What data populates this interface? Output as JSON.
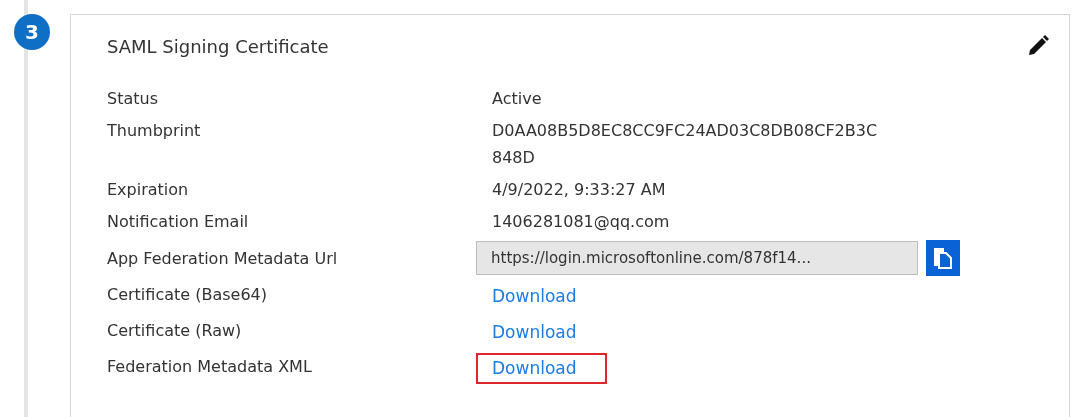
{
  "step": {
    "number": "3"
  },
  "card": {
    "title": "SAML Signing Certificate",
    "rows": [
      {
        "kind": "text",
        "label": "Status",
        "value": "Active"
      },
      {
        "kind": "text",
        "label": "Thumbprint",
        "value": "D0AA08B5D8EC8CC9FC24AD03C8DB08CF2B3C848D"
      },
      {
        "kind": "text",
        "label": "Expiration",
        "value": "4/9/2022, 9:33:27 AM"
      },
      {
        "kind": "text",
        "label": "Notification Email",
        "value": "1406281081@qq.com"
      },
      {
        "kind": "field",
        "label": "App Federation Metadata Url",
        "value": "https://login.microsoftonline.com/878f14..."
      },
      {
        "kind": "link",
        "label": "Certificate (Base64)",
        "value": "Download",
        "highlighted": false
      },
      {
        "kind": "link",
        "label": "Certificate (Raw)",
        "value": "Download",
        "highlighted": false
      },
      {
        "kind": "link",
        "label": "Federation Metadata XML",
        "value": "Download",
        "highlighted": true
      }
    ]
  }
}
